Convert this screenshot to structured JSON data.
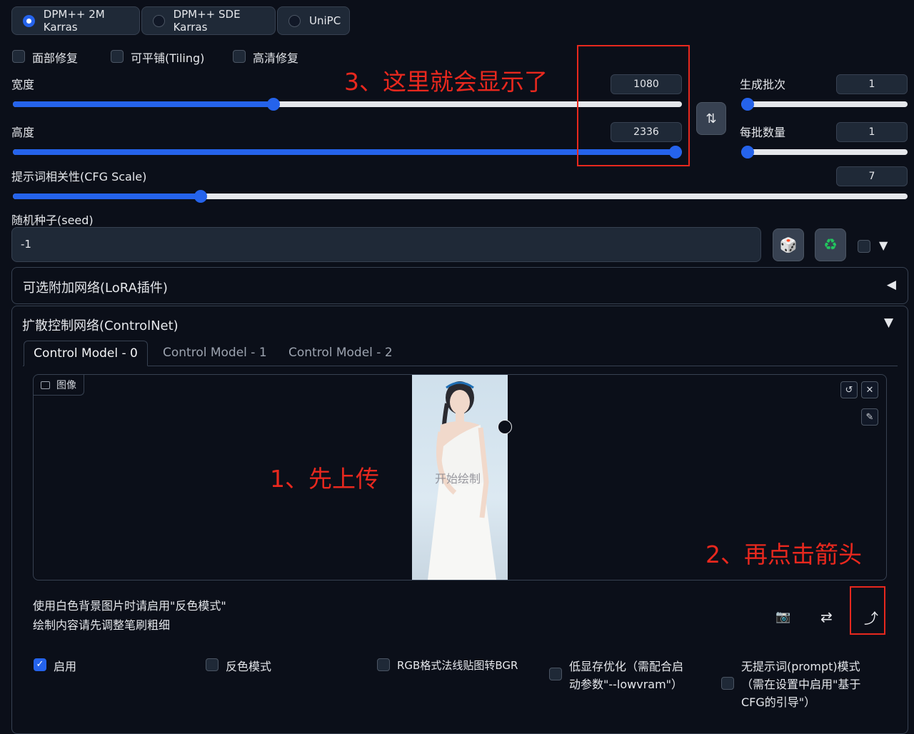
{
  "sampler": {
    "options": [
      {
        "label": "DPM++ 2M Karras",
        "selected": true
      },
      {
        "label": "DPM++ SDE Karras",
        "selected": false
      },
      {
        "label": "UniPC",
        "selected": false
      }
    ]
  },
  "toggles": {
    "face_restore": "面部修复",
    "tiling": "可平铺(Tiling)",
    "hires_fix": "高清修复"
  },
  "width": {
    "label": "宽度",
    "value": "1080",
    "fraction": 0.39
  },
  "height": {
    "label": "高度",
    "value": "2336",
    "fraction": 0.99
  },
  "batch_count": {
    "label": "生成批次",
    "value": "1",
    "fraction": 0.0
  },
  "batch_size": {
    "label": "每批数量",
    "value": "1",
    "fraction": 0.0
  },
  "swap_icon": "⇅",
  "cfg": {
    "label": "提示词相关性(CFG Scale)",
    "value": "7",
    "fraction": 0.21
  },
  "seed": {
    "label": "随机种子(seed)",
    "value": "-1",
    "dice_icon": "🎲",
    "recycle_icon": "♻",
    "expand_icon": "▼"
  },
  "lora": {
    "title": "可选附加网络(LoRA插件)",
    "icon": "◀"
  },
  "controlnet": {
    "title": "扩散控制网络(ControlNet)",
    "icon": "▼",
    "tabs": [
      "Control Model - 0",
      "Control Model - 1",
      "Control Model - 2"
    ],
    "image_label": "图像",
    "watermark": "开始绘制",
    "hint_line1": "使用白色背景图片时请启用\"反色模式\"",
    "hint_line2": "绘制内容请先调整笔刷粗细",
    "camera_icon": "📷",
    "swap_icon": "⇄",
    "send_icon": "⤴",
    "undo_icon": "↺",
    "close_icon": "✕",
    "brush_icon": "✎",
    "options": {
      "enable": "启用",
      "invert": "反色模式",
      "rgb_bgr": "RGB格式法线贴图转BGR",
      "lowvram_1": "低显存优化（需配合启",
      "lowvram_2": "动参数\"--lowvram\"）",
      "guess_1": "无提示词(prompt)模式",
      "guess_2": "（需在设置中启用\"基于",
      "guess_3": "CFG的引导\"）"
    }
  },
  "annotations": {
    "step1": "1、先上传",
    "step2": "2、再点击箭头",
    "step3": "3、这里就会显示了"
  },
  "colors": {
    "accent": "#2563eb",
    "annotation": "#e8281e",
    "background": "#0b0f19"
  }
}
